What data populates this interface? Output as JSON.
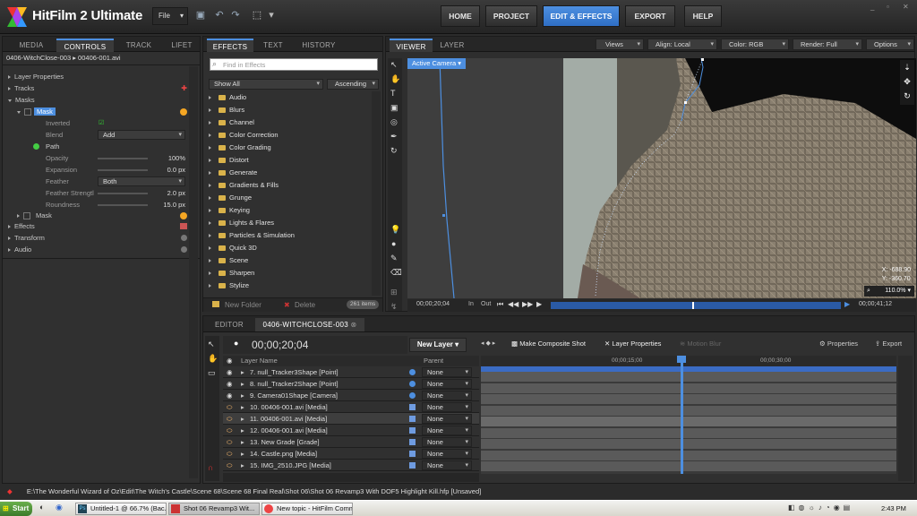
{
  "app": {
    "title": "HitFilm 2 Ultimate",
    "file_menu": "File"
  },
  "nav": {
    "home": "HOME",
    "project": "PROJECT",
    "edit": "EDIT & EFFECTS",
    "export": "EXPORT",
    "help": "HELP"
  },
  "left": {
    "tabs": [
      "MEDIA",
      "CONTROLS",
      "TRACK",
      "LIFET"
    ],
    "breadcrumb": "0406-WitchClose-003 ▸ 00406-001.avi",
    "rows": {
      "layer_props": "Layer Properties",
      "tracks": "Tracks",
      "masks": "Masks",
      "mask": "Mask",
      "inverted": "Inverted",
      "blend": "Blend",
      "blend_val": "Add",
      "path": "Path",
      "opacity": "Opacity",
      "opacity_val": "100%",
      "expansion": "Expansion",
      "expansion_val": "0.0 px",
      "feather": "Feather",
      "feather_val": "Both",
      "feather_strength": "Feather Strengtl",
      "feather_strength_val": "2.0 px",
      "roundness": "Roundness",
      "roundness_val": "15.0 px",
      "mask2": "Mask",
      "effects": "Effects",
      "transform": "Transform",
      "audio": "Audio"
    }
  },
  "effects": {
    "tabs": [
      "EFFECTS",
      "TEXT",
      "HISTORY"
    ],
    "search_placeholder": "Find in Effects",
    "show": "Show All",
    "sort": "Ascending",
    "items": [
      "Audio",
      "Blurs",
      "Channel",
      "Color Correction",
      "Color Grading",
      "Distort",
      "Generate",
      "Gradients & Fills",
      "Grunge",
      "Keying",
      "Lights & Flares",
      "Particles & Simulation",
      "Quick 3D",
      "Scene",
      "Sharpen",
      "Stylize"
    ],
    "new_folder": "New Folder",
    "delete": "Delete",
    "count": "261 items"
  },
  "viewer": {
    "tabs": [
      "VIEWER",
      "LAYER"
    ],
    "views": "Views",
    "align": "Align: Local",
    "color": "Color: RGB",
    "render": "Render: Full",
    "options": "Options",
    "camera": "Active Camera",
    "x": "X:   -688.90",
    "y": "Y:   -360.70",
    "zoom": "110.0%",
    "time_start": "00;00;20;04",
    "in": "In",
    "out": "Out",
    "time_end": "00;00;41;12"
  },
  "timeline": {
    "tabs": [
      "EDITOR",
      "0406-WITCHCLOSE-003"
    ],
    "time": "00;00;20;04",
    "new_layer": "New Layer",
    "composite": "Make Composite Shot",
    "layer_props": "Layer Properties",
    "motion_blur": "Motion Blur",
    "properties": "Properties",
    "export": "Export",
    "col_layer": "Layer Name",
    "col_parent": "Parent",
    "ruler": [
      "00;00;15;00",
      "00;00;30;00"
    ],
    "layers": [
      {
        "name": "7. null_Tracker3Shape [Point]",
        "parent": "None"
      },
      {
        "name": "8. null_Tracker2Shape [Point]",
        "parent": "None"
      },
      {
        "name": "9. Camera01Shape [Camera]",
        "parent": "None"
      },
      {
        "name": "10. 00406-001.avi [Media]",
        "parent": "None"
      },
      {
        "name": "11. 00406-001.avi [Media]",
        "parent": "None"
      },
      {
        "name": "12. 00406-001.avi [Media]",
        "parent": "None"
      },
      {
        "name": "13. New Grade [Grade]",
        "parent": "None"
      },
      {
        "name": "14. Castle.png [Media]",
        "parent": "None"
      },
      {
        "name": "15. IMG_2510.JPG [Media]",
        "parent": "None"
      }
    ]
  },
  "status": "E:\\The Wonderful Wizard of Oz\\Edit\\The Witch's Castle\\Scene 68\\Scene 68 Final Real\\Shot 06\\Shot 06 Revamp3 With DOF5 Highlight Kill.hfp   [Unsaved]",
  "taskbar": {
    "start": "Start",
    "tasks": [
      "Untitled-1 @ 66.7% (Bac...",
      "Shot 06 Revamp3 Wit...",
      "New topic - HitFilm Comm..."
    ],
    "clock": "2:43 PM"
  },
  "colors": {
    "accent": "#4d8fe0",
    "panel": "#303030",
    "bg": "#2b2b2b"
  }
}
